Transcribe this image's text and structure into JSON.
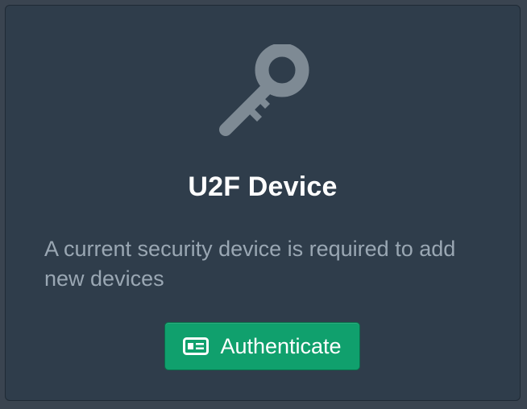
{
  "card": {
    "title": "U2F Device",
    "description": "A current security device is required to add new devices",
    "icon": "key-icon"
  },
  "button": {
    "label": "Authenticate",
    "icon": "id-card-icon"
  },
  "colors": {
    "card_background": "#2f3d4b",
    "icon": "#7e8a94",
    "button": "#10a06d",
    "text_primary": "#ffffff",
    "text_secondary": "#9aa7b3"
  }
}
